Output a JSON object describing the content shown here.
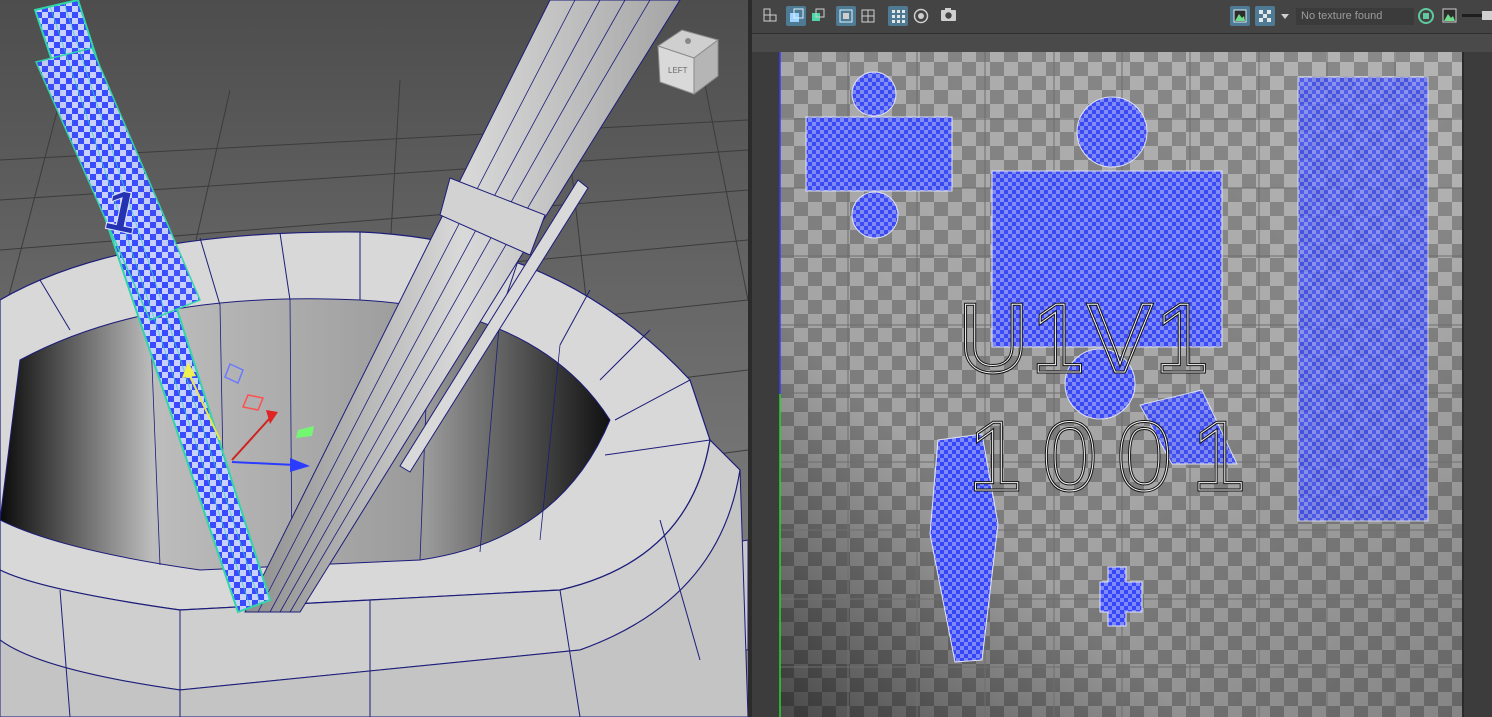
{
  "viewport": {
    "view_cube_label": "LEFT",
    "shell_label": "1"
  },
  "uv_toolbar": {
    "texture_status": "No texture found",
    "buttons": [
      "uv-shell-icon",
      "uv-select-icon",
      "uv-move-icon",
      "uv-frame-icon",
      "uv-grid-icon",
      "uv-pixel-snap-icon",
      "uv-shade-icon",
      "uv-snapshot-icon",
      "display-image-icon",
      "checker-icon",
      "dropdown-icon",
      "refresh-icon",
      "image-icon"
    ]
  },
  "uv_editor": {
    "tile_label_uv": "U1V1",
    "tile_label_udim": "1001"
  },
  "colors": {
    "uv_shell_fill": "#3a4bff",
    "selection": "#2fd6a8",
    "wireframe": "#1d1d7a",
    "active_button": "#4f7a94"
  }
}
